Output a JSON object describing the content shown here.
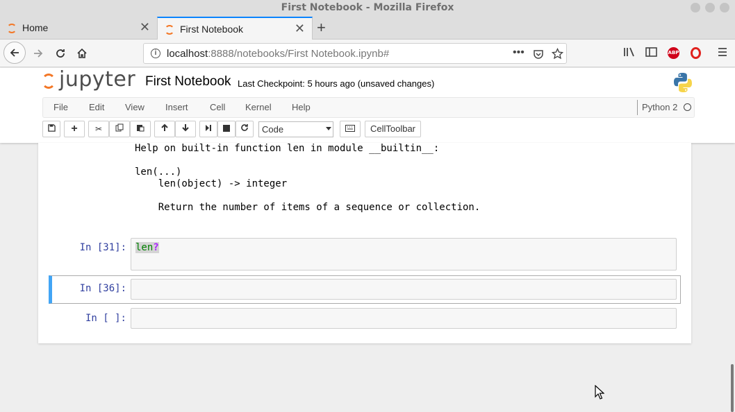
{
  "window": {
    "title": "First Notebook - Mozilla Firefox"
  },
  "tabs": [
    {
      "label": "Home",
      "close": "✕"
    },
    {
      "label": "First Notebook",
      "close": "✕"
    }
  ],
  "newtab_label": "+",
  "url": {
    "host": "localhost",
    "rest": ":8888/notebooks/First Notebook.ipynb#"
  },
  "jupyter": {
    "logo_text": "jupyter",
    "notebook_name": "First Notebook",
    "checkpoint": "Last Checkpoint: 5 hours ago (unsaved changes)",
    "menu": [
      "File",
      "Edit",
      "View",
      "Insert",
      "Cell",
      "Kernel",
      "Help"
    ],
    "kernel": "Python 2",
    "cell_type": "Code",
    "celltoolbar_label": "CellToolbar"
  },
  "output": {
    "line1": "Help on built-in function len in module __builtin__:",
    "line2": "len(...)",
    "line3": "    len(object) -> integer",
    "line4": "    Return the number of items of a sequence or collection."
  },
  "cells": [
    {
      "prompt": "In [31]:",
      "code_name": "len",
      "code_op": "?"
    },
    {
      "prompt": "In [36]:"
    },
    {
      "prompt": "In [ ]:"
    }
  ],
  "colors": {
    "jupyter_orange": "#f37726",
    "selected_cell_bar": "#42a5f5",
    "prompt_blue": "#303f9f",
    "firefox_blue": "#0a84ff"
  }
}
